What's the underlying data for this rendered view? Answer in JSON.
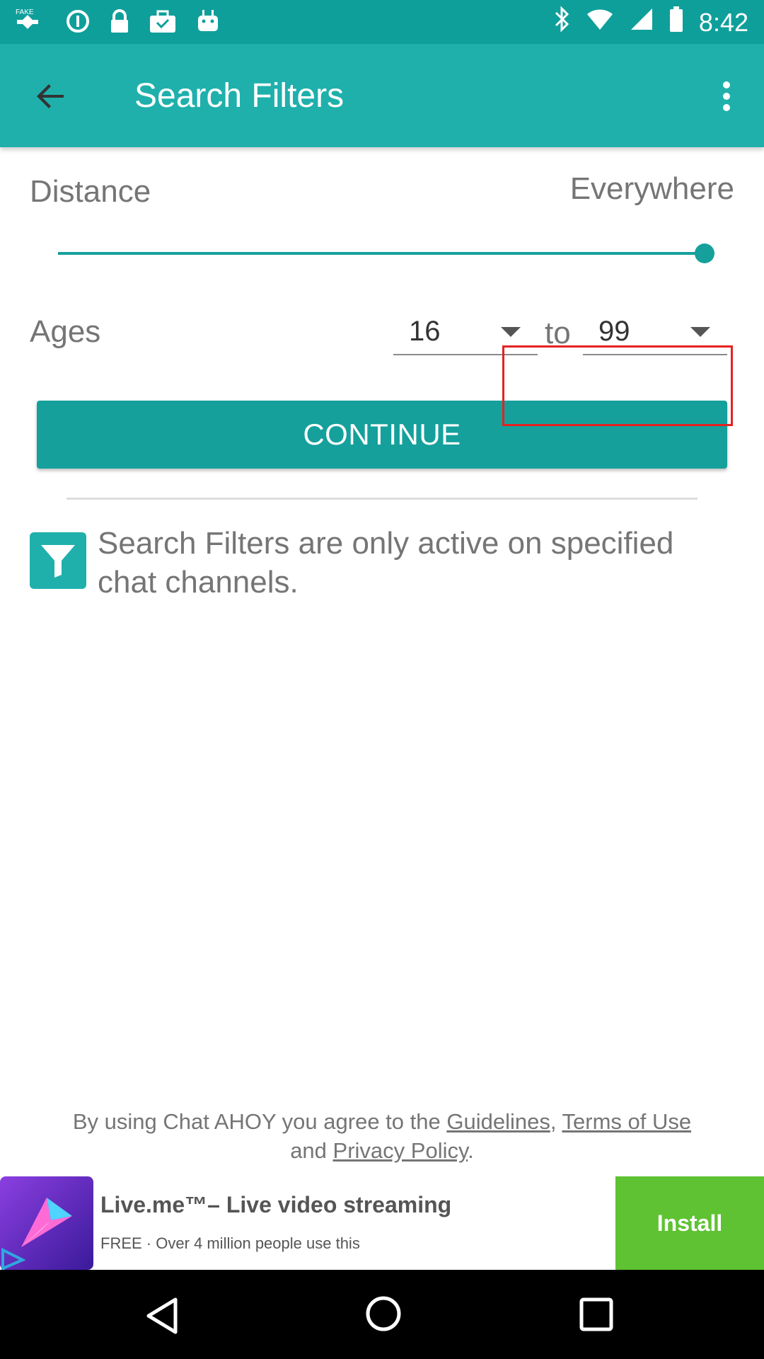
{
  "status_bar": {
    "time": "8:42",
    "icons": [
      "fake-gps-icon",
      "data-saver-icon",
      "lock-icon",
      "briefcase-icon",
      "android-icon",
      "bluetooth-icon",
      "wifi-icon",
      "cell-signal-icon",
      "battery-icon"
    ]
  },
  "app_bar": {
    "title": "Search Filters",
    "back_icon": "arrow-back-icon",
    "menu_icon": "more-vert-icon"
  },
  "distance": {
    "label": "Distance",
    "value": "Everywhere",
    "slider_fraction": 1.0
  },
  "ages": {
    "label": "Ages",
    "min": "16",
    "to_label": "to",
    "max": "99"
  },
  "continue_label": "CONTINUE",
  "info": {
    "icon": "filter-icon",
    "text": "Search Filters are only active on specified chat channels."
  },
  "footer": {
    "prefix": "By using Chat AHOY you agree to the ",
    "guidelines": "Guidelines",
    "comma": ", ",
    "terms": "Terms of Use",
    "and": "and ",
    "privacy": "Privacy Policy",
    "period": "."
  },
  "ad": {
    "title": "Live.me™– Live video streaming",
    "subtitle": "FREE · Over 4 million people use this",
    "install_label": "Install"
  },
  "colors": {
    "accent": "#15a09c",
    "app_bar": "#1fb0ac",
    "status_bar": "#0f9f9b",
    "highlight": "#e52222",
    "install": "#5ec232"
  }
}
